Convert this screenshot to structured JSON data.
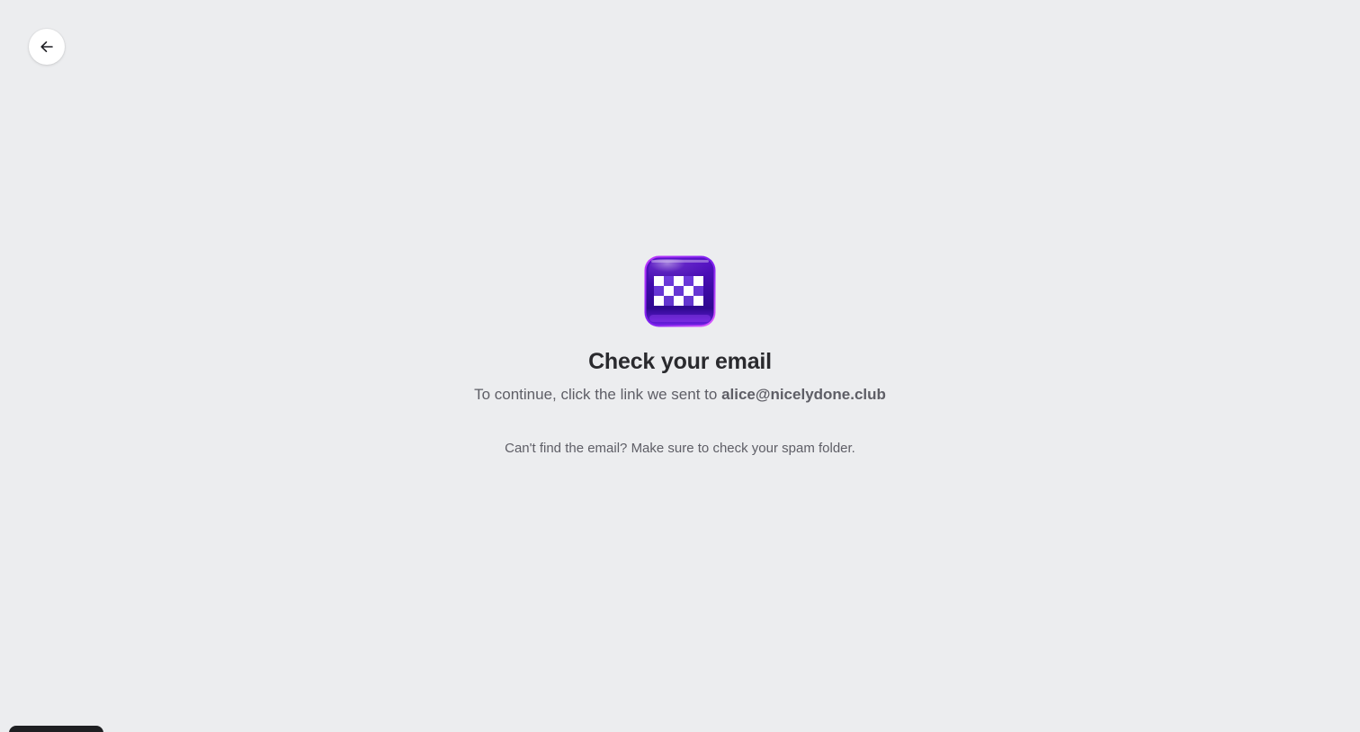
{
  "back_button": {
    "icon": "arrow-left-icon"
  },
  "logo": {
    "icon": "checkered-app-icon",
    "color_dark": "#3b0a9e",
    "color_light": "#8a2cf0",
    "rim": "#d04dff"
  },
  "heading": {
    "title": "Check your email"
  },
  "message": {
    "prefix": "To continue, click the link we sent to ",
    "email": "alice@nicelydone.club"
  },
  "hint": {
    "text": "Can't find the email? Make sure to check your spam folder."
  },
  "colors": {
    "background": "#ecedef",
    "title": "#2a2a2e",
    "body_text": "#5e5e66"
  }
}
